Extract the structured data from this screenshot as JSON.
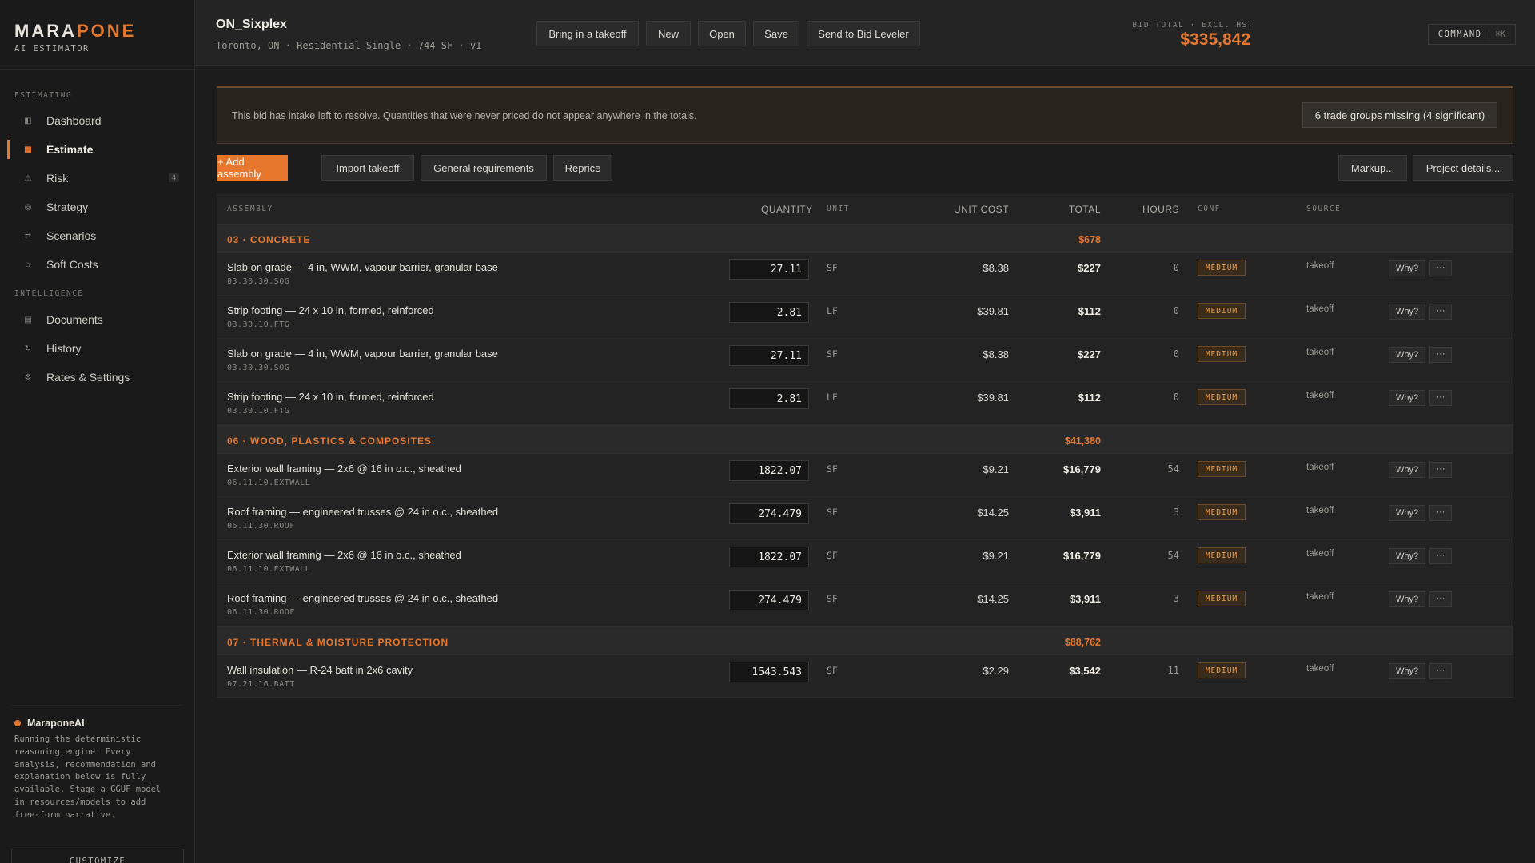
{
  "brand": {
    "name_a": "MARA",
    "name_b": "PONE",
    "subtitle": "AI ESTIMATOR"
  },
  "sidebar": {
    "section_estimating": "ESTIMATING",
    "section_intelligence": "INTELLIGENCE",
    "items": [
      {
        "label": "Dashboard",
        "icon": "dashboard-icon",
        "glyph": "◧"
      },
      {
        "label": "Estimate",
        "icon": "estimate-icon",
        "glyph": "▦",
        "active": true
      },
      {
        "label": "Risk",
        "icon": "warning-icon",
        "glyph": "⚠",
        "badge": "4"
      },
      {
        "label": "Strategy",
        "icon": "strategy-icon",
        "glyph": "◎"
      },
      {
        "label": "Scenarios",
        "icon": "scenarios-icon",
        "glyph": "⇄"
      },
      {
        "label": "Soft Costs",
        "icon": "soft-costs-icon",
        "glyph": "⌂"
      },
      {
        "label": "Documents",
        "icon": "documents-icon",
        "glyph": "▤"
      },
      {
        "label": "History",
        "icon": "history-icon",
        "glyph": "↻"
      },
      {
        "label": "Rates & Settings",
        "icon": "settings-icon",
        "glyph": "⚙"
      }
    ],
    "ai": {
      "title": "MaraponeAI",
      "text": "Running the deterministic reasoning engine. Every analysis, recommendation and explanation below is fully available. Stage a GGUF model in resources/models to add free-form narrative."
    },
    "customize": "CUSTOMIZE"
  },
  "header": {
    "project_name": "ON_Sixplex",
    "project_meta": "Toronto, ON · Residential Single · 744 SF · v1",
    "buttons": [
      "Bring in a takeoff",
      "New",
      "Open",
      "Save",
      "Send to Bid Leveler"
    ],
    "bid_label": "BID TOTAL · EXCL. HST",
    "bid_value": "$335,842",
    "command_label": "COMMAND",
    "command_key": "⌘K"
  },
  "alert": {
    "text": "This bid has intake left to resolve. Quantities that were never priced do not appear anywhere in the totals.",
    "button": "6 trade groups missing (4 significant)"
  },
  "toolbar": {
    "add_assembly": "+ Add assembly",
    "import_takeoff": "Import takeoff",
    "general_requirements": "General requirements",
    "reprice": "Reprice",
    "markup": "Markup...",
    "project_details": "Project details..."
  },
  "table": {
    "headers": {
      "assembly": "ASSEMBLY",
      "quantity": "QUANTITY",
      "unit": "UNIT",
      "unit_cost": "UNIT COST",
      "total": "TOTAL",
      "hours": "HOURS",
      "conf": "CONF",
      "source": "SOURCE"
    },
    "groups": [
      {
        "name": "03 · CONCRETE",
        "total": "$678",
        "rows": [
          {
            "name": "Slab on grade — 4 in, WWM, vapour barrier, granular base",
            "code": "03.30.30.SOG",
            "qty": "27.11",
            "unit": "SF",
            "unit_cost": "$8.38",
            "total": "$227",
            "hours": "0",
            "conf": "MEDIUM",
            "source": "takeoff"
          },
          {
            "name": "Strip footing — 24 x 10 in, formed, reinforced",
            "code": "03.30.10.FTG",
            "qty": "2.81",
            "unit": "LF",
            "unit_cost": "$39.81",
            "total": "$112",
            "hours": "0",
            "conf": "MEDIUM",
            "source": "takeoff"
          },
          {
            "name": "Slab on grade — 4 in, WWM, vapour barrier, granular base",
            "code": "03.30.30.SOG",
            "qty": "27.11",
            "unit": "SF",
            "unit_cost": "$8.38",
            "total": "$227",
            "hours": "0",
            "conf": "MEDIUM",
            "source": "takeoff"
          },
          {
            "name": "Strip footing — 24 x 10 in, formed, reinforced",
            "code": "03.30.10.FTG",
            "qty": "2.81",
            "unit": "LF",
            "unit_cost": "$39.81",
            "total": "$112",
            "hours": "0",
            "conf": "MEDIUM",
            "source": "takeoff"
          }
        ]
      },
      {
        "name": "06 · WOOD, PLASTICS & COMPOSITES",
        "total": "$41,380",
        "rows": [
          {
            "name": "Exterior wall framing — 2x6 @ 16 in o.c., sheathed",
            "code": "06.11.10.EXTWALL",
            "qty": "1822.07",
            "unit": "SF",
            "unit_cost": "$9.21",
            "total": "$16,779",
            "hours": "54",
            "conf": "MEDIUM",
            "source": "takeoff"
          },
          {
            "name": "Roof framing — engineered trusses @ 24 in o.c., sheathed",
            "code": "06.11.30.ROOF",
            "qty": "274.479",
            "unit": "SF",
            "unit_cost": "$14.25",
            "total": "$3,911",
            "hours": "3",
            "conf": "MEDIUM",
            "source": "takeoff"
          },
          {
            "name": "Exterior wall framing — 2x6 @ 16 in o.c., sheathed",
            "code": "06.11.10.EXTWALL",
            "qty": "1822.07",
            "unit": "SF",
            "unit_cost": "$9.21",
            "total": "$16,779",
            "hours": "54",
            "conf": "MEDIUM",
            "source": "takeoff"
          },
          {
            "name": "Roof framing — engineered trusses @ 24 in o.c., sheathed",
            "code": "06.11.30.ROOF",
            "qty": "274.479",
            "unit": "SF",
            "unit_cost": "$14.25",
            "total": "$3,911",
            "hours": "3",
            "conf": "MEDIUM",
            "source": "takeoff"
          }
        ]
      },
      {
        "name": "07 · THERMAL & MOISTURE PROTECTION",
        "total": "$88,762",
        "rows": [
          {
            "name": "Wall insulation — R-24 batt in 2x6 cavity",
            "code": "07.21.16.BATT",
            "qty": "1543.543",
            "unit": "SF",
            "unit_cost": "$2.29",
            "total": "$3,542",
            "hours": "11",
            "conf": "MEDIUM",
            "source": "takeoff"
          }
        ]
      }
    ],
    "row_why": "Why?",
    "row_more": "···"
  }
}
